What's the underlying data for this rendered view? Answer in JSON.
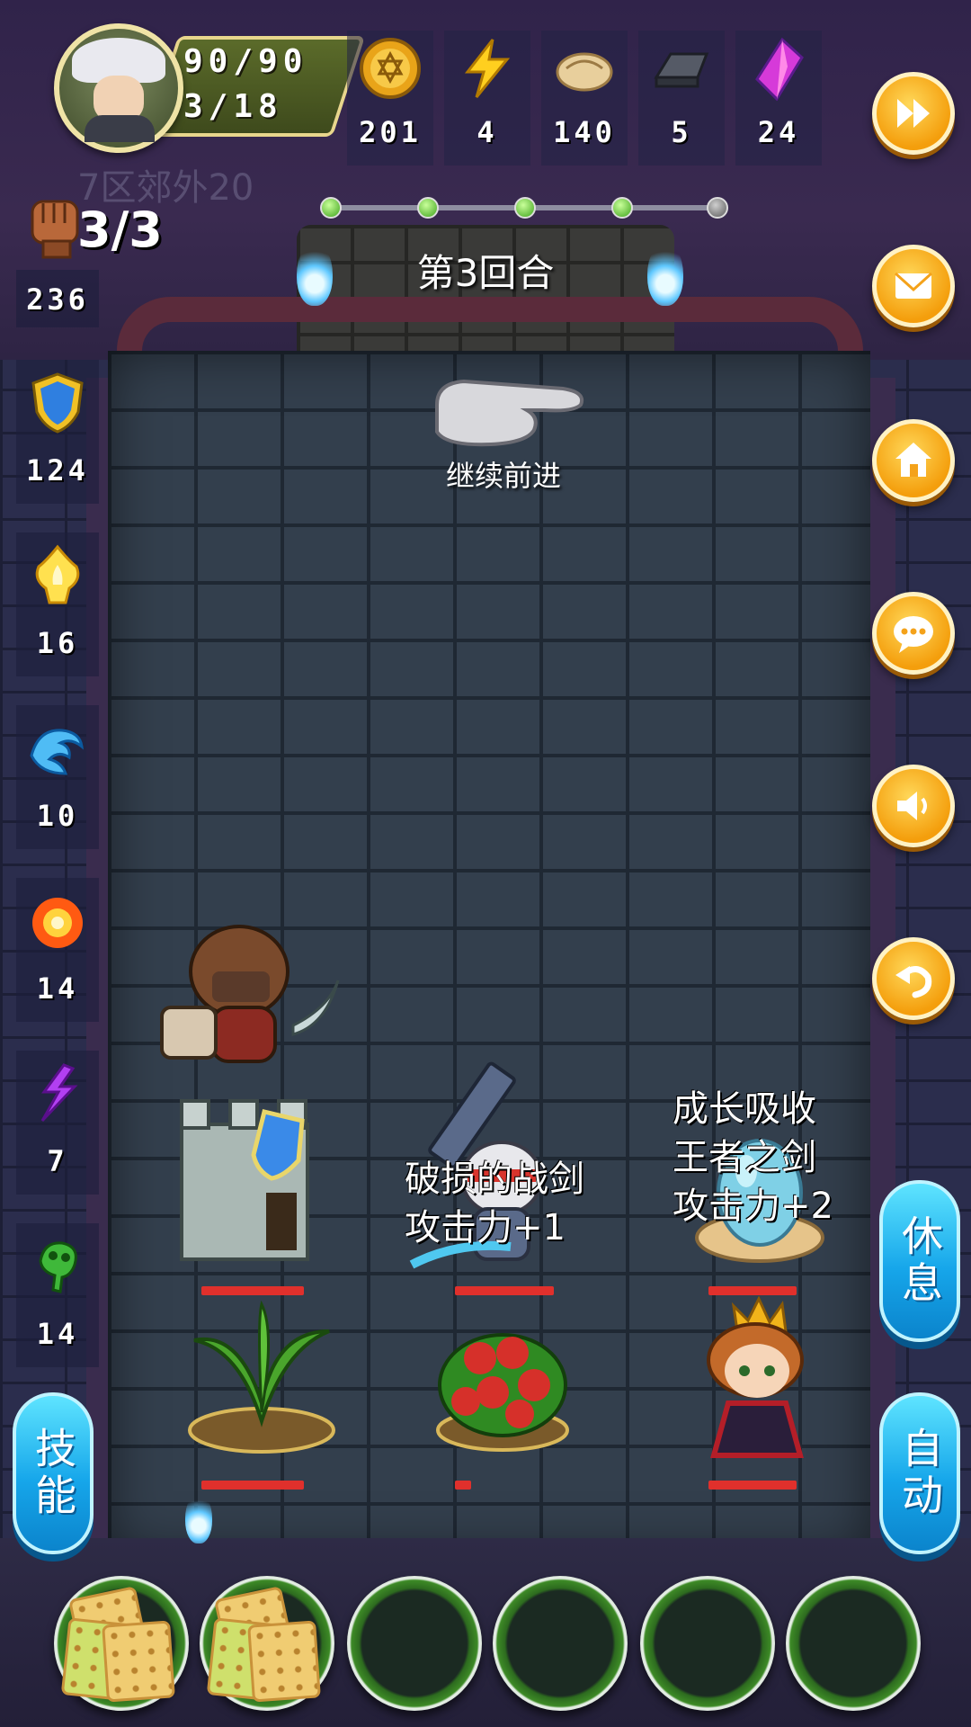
{
  "player": {
    "hp": "90/90",
    "level": "3/18",
    "zone": "7区郊外20"
  },
  "resources": [
    {
      "name": "gold",
      "icon": "gold-coin-icon",
      "value": "201"
    },
    {
      "name": "energy",
      "icon": "lightning-icon",
      "value": "4"
    },
    {
      "name": "bread",
      "icon": "bread-icon",
      "value": "140"
    },
    {
      "name": "iron",
      "icon": "iron-ingot-icon",
      "value": "5"
    },
    {
      "name": "crystal",
      "icon": "crystal-icon",
      "value": "24"
    }
  ],
  "attack_count": "3/3",
  "stats": [
    {
      "icon": "fist-icon",
      "value": "236"
    },
    {
      "icon": "shield-icon",
      "value": "124"
    },
    {
      "icon": "holy-flame-icon",
      "value": "16"
    },
    {
      "icon": "water-wave-icon",
      "value": "10"
    },
    {
      "icon": "fire-icon",
      "value": "14"
    },
    {
      "icon": "purple-lightning-icon",
      "value": "7"
    },
    {
      "icon": "green-poison-icon",
      "value": "14"
    }
  ],
  "stage": {
    "round_text": "第3回合",
    "progress_nodes": [
      true,
      true,
      true,
      true,
      false
    ],
    "hint": "继续前进"
  },
  "right_buttons": [
    {
      "name": "fast-forward",
      "icon": "fast-forward-icon"
    },
    {
      "name": "mail",
      "icon": "mail-icon"
    },
    {
      "name": "home",
      "icon": "home-icon"
    },
    {
      "name": "chat",
      "icon": "chat-icon"
    },
    {
      "name": "sound",
      "icon": "speaker-icon"
    },
    {
      "name": "back",
      "icon": "undo-icon"
    }
  ],
  "side_buttons": {
    "skill": "技能",
    "rest": "休息",
    "auto": "自动"
  },
  "board": {
    "sword_float": "破损的战剑\n攻击力+1",
    "egg_float": "成长吸收\n王者之剑\n攻击力+2"
  },
  "slots": [
    {
      "item": "biscuit-icon"
    },
    {
      "item": "biscuit-icon"
    },
    {
      "item": ""
    },
    {
      "item": ""
    },
    {
      "item": ""
    },
    {
      "item": ""
    }
  ],
  "colors": {
    "hp_bar": "#e0302c",
    "round_button": "#f49e0c",
    "pill_button": "#16a6ea"
  }
}
